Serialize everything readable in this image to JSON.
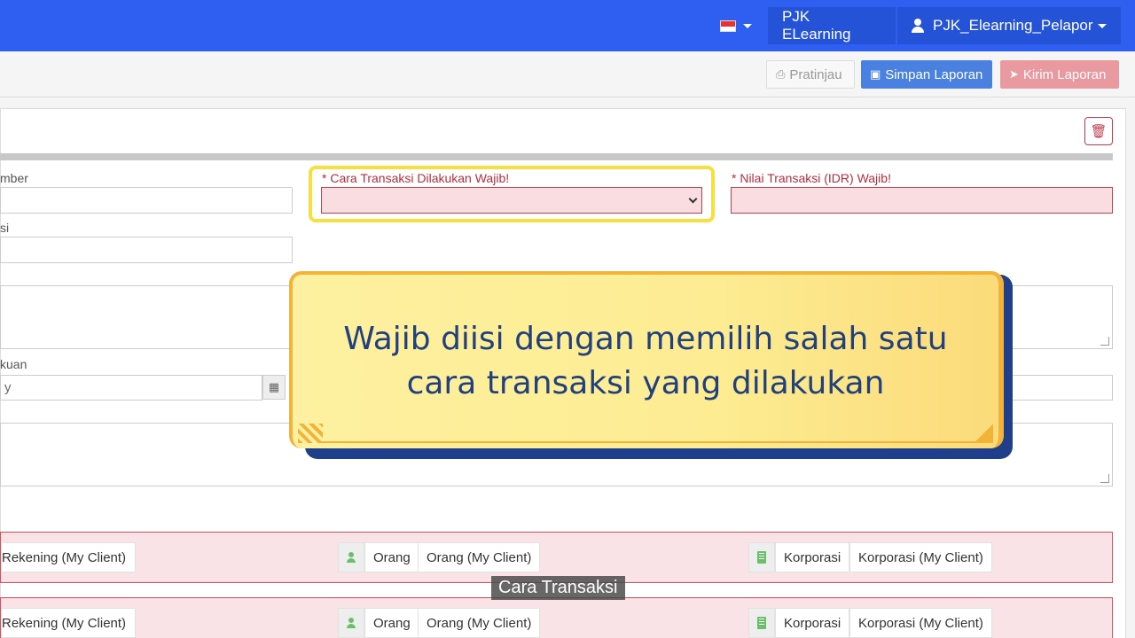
{
  "navbar": {
    "home_label": "PJK ELearning",
    "user_label": "PJK_Elearning_Pelapor",
    "flag_colors": [
      "#e63232",
      "#ffffff"
    ]
  },
  "toolbar": {
    "preview_label": "Pratinjau",
    "save_label": "Simpan Laporan",
    "send_label": "Kirim Laporan"
  },
  "form": {
    "field1_label": "mber",
    "field2_label": "si",
    "field3_label": "kuan",
    "field3_value": "y",
    "transaction_method_label": "* Cara Transaksi Dilakukan Wajib!",
    "transaction_value_label": "* Nilai Transaksi (IDR) Wajib!"
  },
  "rows": [
    {
      "account_chip": "Rekening (My Client)",
      "person_type": "Orang",
      "person_chip": "Orang (My Client)",
      "corp_type": "Korporasi",
      "corp_chip": "Korporasi (My Client)"
    },
    {
      "account_chip": "Rekening (My Client)",
      "person_type": "Orang",
      "person_chip": "Orang (My Client)",
      "corp_type": "Korporasi",
      "corp_chip": "Korporasi (My Client)"
    }
  ],
  "callout": {
    "line1": "Wajib diisi dengan memilih salah satu",
    "line2": "cara transaksi yang dilakukan"
  },
  "subtitle": "Cara Transaksi",
  "colors": {
    "navbar": "#2f5ff0",
    "save_button": "#4a80e0",
    "send_button": "#e99aa0",
    "error": "#b5303f",
    "callout_text": "#22407c"
  }
}
